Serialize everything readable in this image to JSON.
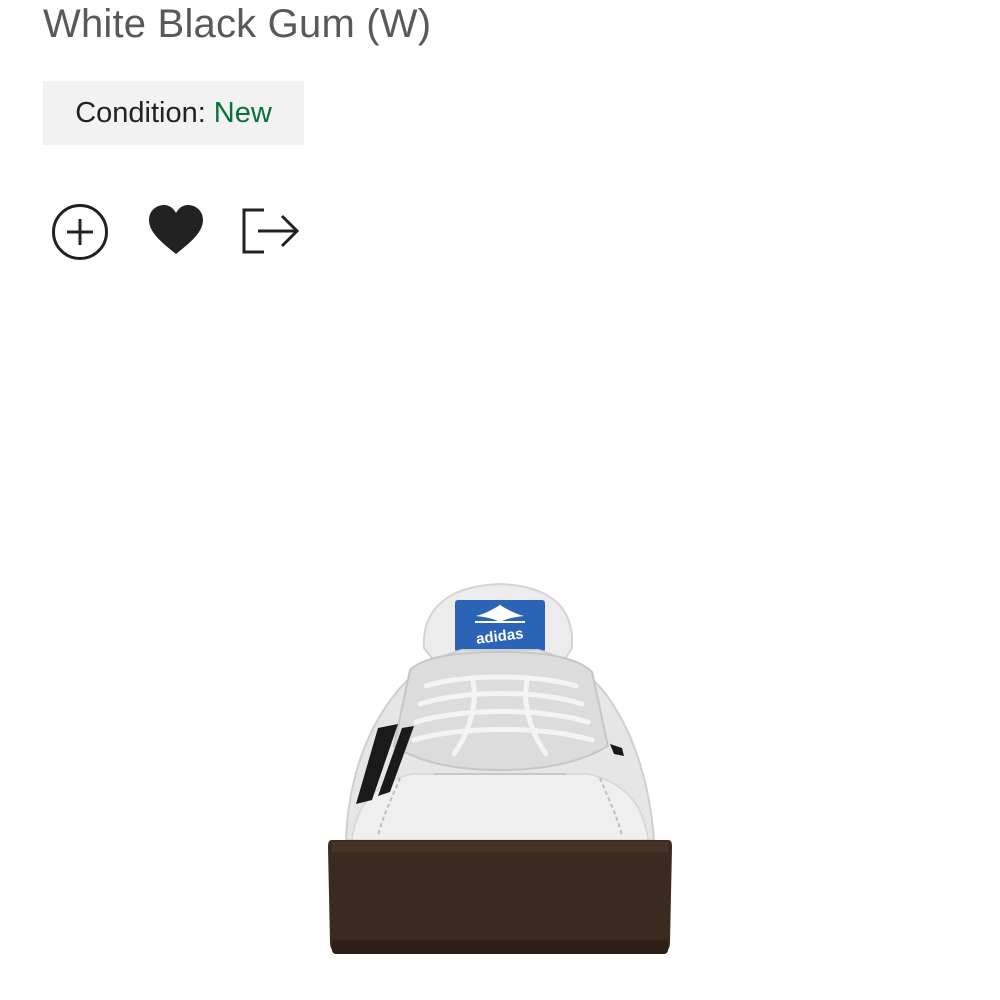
{
  "product": {
    "title": "White Black Gum (W)",
    "condition_label": "Condition:",
    "condition_value": "New"
  },
  "image": {
    "logo_brand": "adidas"
  },
  "colors": {
    "title": "#58595b",
    "condition_bg": "#f2f2f2",
    "condition_value": "#08703a",
    "icon": "#222222"
  },
  "actions": [
    {
      "icon": "add-circle-icon"
    },
    {
      "icon": "heart-icon"
    },
    {
      "icon": "share-exit-icon"
    }
  ]
}
